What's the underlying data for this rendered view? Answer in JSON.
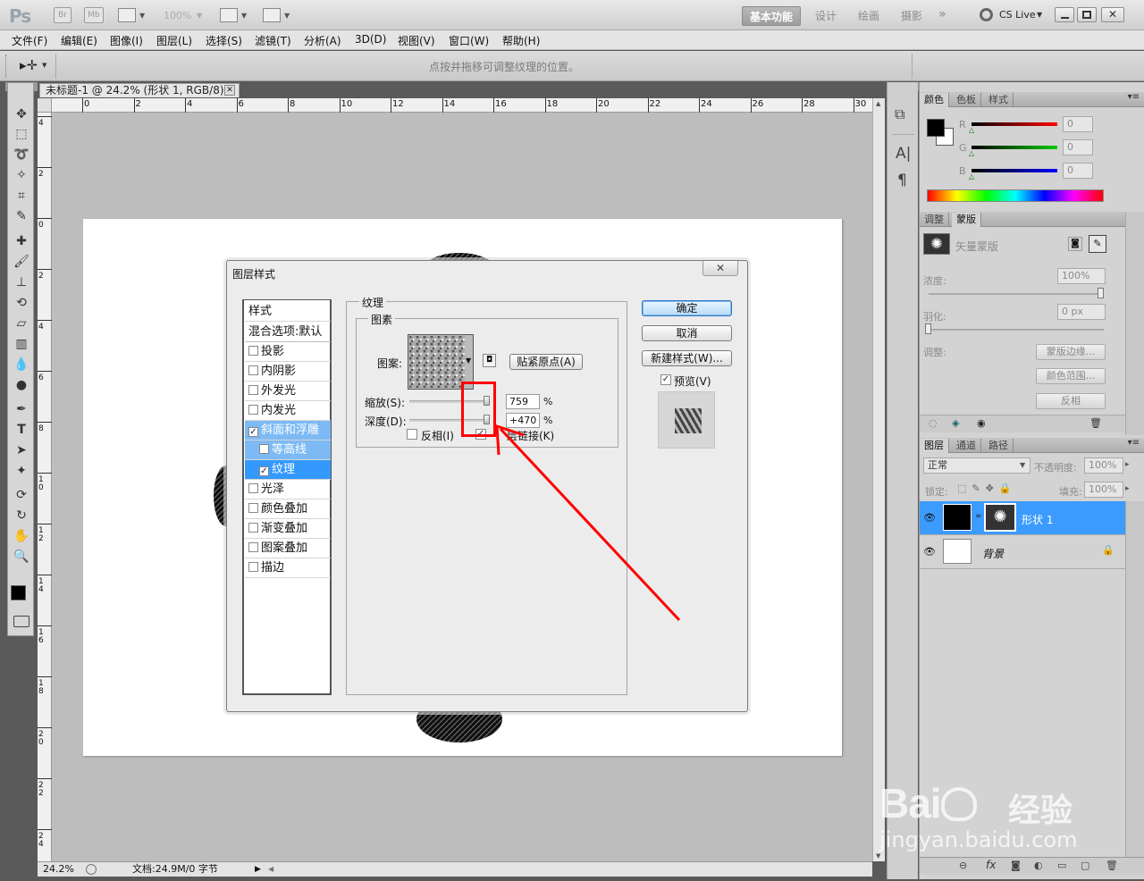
{
  "app": {
    "logo": "Ps",
    "zoom_chip": "100%",
    "cs_live": "CS Live"
  },
  "workspaces": [
    "基本功能",
    "设计",
    "绘画",
    "摄影"
  ],
  "menu": [
    "文件(F)",
    "编辑(E)",
    "图像(I)",
    "图层(L)",
    "选择(S)",
    "滤镜(T)",
    "分析(A)",
    "3D(D)",
    "视图(V)",
    "窗口(W)",
    "帮助(H)"
  ],
  "options_hint": "点按并拖移可调整纹理的位置。",
  "document": {
    "tab_title": "未标题-1 @ 24.2% (形状 1, RGB/8) *",
    "ruler_h": [
      "0",
      "2",
      "4",
      "6",
      "8",
      "10",
      "12",
      "14",
      "16",
      "18",
      "20",
      "22",
      "24",
      "26",
      "28",
      "30"
    ],
    "ruler_v": [
      "4",
      "2",
      "0",
      "2",
      "4",
      "6",
      "8",
      "1\n0",
      "1\n2",
      "1\n4",
      "1\n6",
      "1\n8",
      "2\n0",
      "2\n2",
      "2\n4"
    ],
    "status_zoom": "24.2%",
    "status_doc": "文档:24.9M/0 字节"
  },
  "dialog": {
    "title": "图层样式",
    "styles_header": "样式",
    "blend_options": "混合选项:默认",
    "styles": [
      {
        "label": "投影",
        "checked": false
      },
      {
        "label": "内阴影",
        "checked": false
      },
      {
        "label": "外发光",
        "checked": false
      },
      {
        "label": "内发光",
        "checked": false
      },
      {
        "label": "斜面和浮雕",
        "checked": true
      },
      {
        "label": "等高线",
        "checked": false
      },
      {
        "label": "纹理",
        "checked": true
      },
      {
        "label": "光泽",
        "checked": false
      },
      {
        "label": "颜色叠加",
        "checked": false
      },
      {
        "label": "渐变叠加",
        "checked": false
      },
      {
        "label": "图案叠加",
        "checked": false
      },
      {
        "label": "描边",
        "checked": false
      }
    ],
    "section_title": "纹理",
    "group_title": "图素",
    "pattern_label": "图案:",
    "snap_button": "贴紧原点(A)",
    "scale_label": "缩放(S):",
    "scale_value": "759",
    "depth_label": "深度(D):",
    "depth_value": "+470",
    "percent": "%",
    "invert_label": "反相(I)",
    "link_label": "与图层链接(K)",
    "link_label_visible": "层链接(K)",
    "ok": "确定",
    "cancel": "取消",
    "new_style": "新建样式(W)...",
    "preview_label": "预览(V)",
    "check": "✓"
  },
  "color_panel": {
    "tabs": [
      "颜色",
      "色板",
      "样式"
    ],
    "channels": [
      {
        "label": "R",
        "value": "0",
        "color": "#cc0000"
      },
      {
        "label": "G",
        "value": "0",
        "color": "#00a000"
      },
      {
        "label": "B",
        "value": "0",
        "color": "#0000c0"
      }
    ]
  },
  "mask_panel": {
    "tabs": [
      "调整",
      "蒙版"
    ],
    "mask_type": "矢量蒙版",
    "density_label": "浓度:",
    "density_value": "100%",
    "feather_label": "羽化:",
    "feather_value": "0 px",
    "refine_label": "调整:",
    "mask_edge": "蒙版边缘...",
    "color_range": "颜色范围...",
    "invert": "反相"
  },
  "layers_panel": {
    "tabs": [
      "图层",
      "通道",
      "路径"
    ],
    "blend_mode": "正常",
    "opacity_label": "不透明度:",
    "opacity_value": "100%",
    "lock_label": "锁定:",
    "fill_label": "填充:",
    "fill_value": "100%",
    "layers": [
      {
        "name": "形状 1",
        "selected": true
      },
      {
        "name": "背景",
        "selected": false
      }
    ],
    "footer_fx": "fx"
  },
  "watermark": {
    "brand": "Bai",
    "brand_cn": "经验",
    "url": "jingyan.baidu.com"
  },
  "colors": {
    "accent": "#3399ff",
    "annotation": "#ff0000"
  }
}
